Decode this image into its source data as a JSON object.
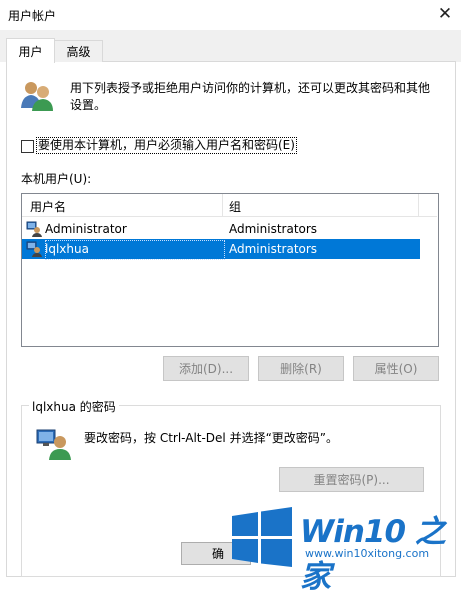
{
  "window": {
    "title": "用户帐户",
    "close_glyph": "✕"
  },
  "tabs": [
    {
      "label": "用户",
      "active": true
    },
    {
      "label": "高级",
      "active": false
    }
  ],
  "intro": {
    "line1": "用下列表授予或拒绝用户访问你的计算机，还可以更改其密码和其他",
    "line2": "设置。"
  },
  "require_login": {
    "label": "要使用本计算机，用户必须输入用户名和密码(E)",
    "checked": false
  },
  "users_section": {
    "label": "本机用户(U):"
  },
  "user_table": {
    "columns": [
      "用户名",
      "组"
    ],
    "rows": [
      {
        "name": "Administrator",
        "group": "Administrators",
        "selected": false
      },
      {
        "name": "lqlxhua",
        "group": "Administrators",
        "selected": true
      }
    ]
  },
  "actions": {
    "add": "添加(D)...",
    "remove": "删除(R)",
    "properties": "属性(O)"
  },
  "password_group": {
    "title": "lqlxhua 的密码",
    "hint": "要改密码，按 Ctrl-Alt-Del 并选择“更改密码”。",
    "reset_button": "重置密码(P)..."
  },
  "footer": {
    "ok_label": "确"
  },
  "watermark": {
    "brand": "Win10 之家",
    "url": "www.win10xitong.com"
  },
  "colors": {
    "selection": "#0078d7",
    "watermark": "#1a73c8"
  }
}
